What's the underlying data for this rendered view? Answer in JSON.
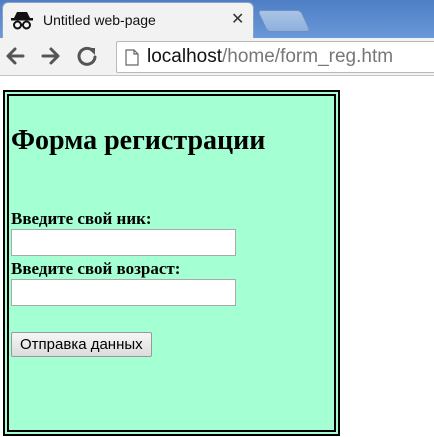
{
  "browser": {
    "tab_title": "Untitled web-page",
    "tab_icon": "incognito-icon",
    "close_glyph": "✕",
    "url_host": "localhost",
    "url_path": "/home/form_reg.htm"
  },
  "page": {
    "background_color": "#a4ffd2",
    "heading": "Форма регистрации",
    "nickname_label": "Введите свой ник:",
    "nickname_value": "",
    "age_label": "Введите свой возраст:",
    "age_value": "",
    "submit_label": "Отправка данных"
  }
}
